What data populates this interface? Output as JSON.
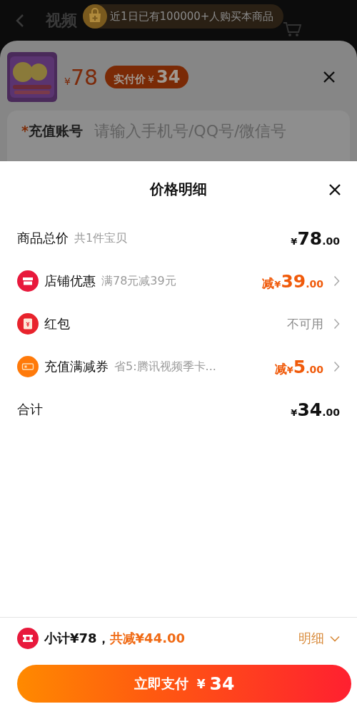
{
  "backdrop": {
    "header_title": "视频",
    "banner": "近1日已有100000+人购买本商品",
    "product": {
      "currency": "¥",
      "price": "78",
      "badge_label": "实付价",
      "badge_currency": "¥",
      "badge_price": "34"
    },
    "account_field": {
      "required_mark": "*",
      "label": "充值账号",
      "placeholder": "请输入手机号/QQ号/微信号"
    }
  },
  "sheet": {
    "title": "价格明细",
    "rows": [
      {
        "kind": "plain",
        "label": "商品总价",
        "note": "共1件宝贝",
        "amount": {
          "currency": "¥",
          "integer": "78",
          "decimals": ".00"
        },
        "highlight": false,
        "chevron": false
      },
      {
        "kind": "shop",
        "label": "店铺优惠",
        "note": "满78元减39元",
        "amount": {
          "prefix": "减",
          "currency": "¥",
          "integer": "39",
          "decimals": ".00"
        },
        "highlight": true,
        "chevron": true
      },
      {
        "kind": "redpacket",
        "label": "红包",
        "value": "不可用",
        "highlight": false,
        "chevron": true
      },
      {
        "kind": "coupon",
        "label": "充值满减券",
        "note": "省5:腾讯视频季卡...",
        "amount": {
          "prefix": "减",
          "currency": "¥",
          "integer": "5",
          "decimals": ".00"
        },
        "highlight": true,
        "chevron": true
      },
      {
        "kind": "plain",
        "label": "合计",
        "amount": {
          "currency": "¥",
          "integer": "34",
          "decimals": ".00"
        },
        "highlight": false,
        "chevron": false
      }
    ]
  },
  "footer": {
    "subtotal": "小计¥78，",
    "discount": "共减¥44.00",
    "details_link": "明细",
    "pay_button": {
      "label": "立即支付",
      "currency": "¥",
      "amount": "34"
    }
  }
}
